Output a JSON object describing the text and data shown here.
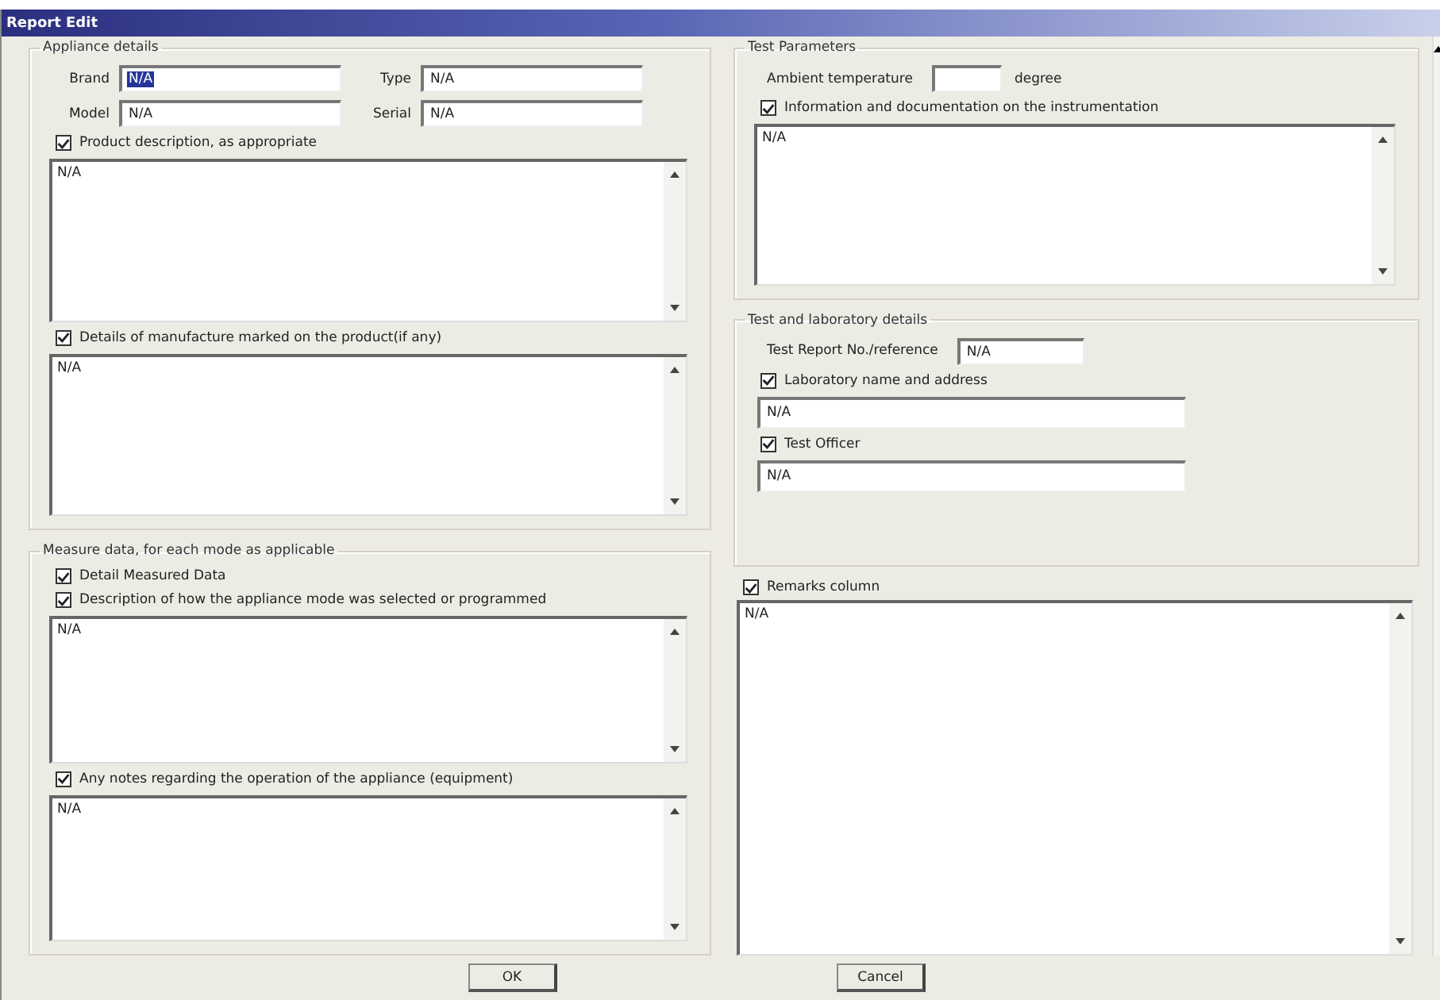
{
  "window": {
    "title": "Report Edit"
  },
  "left_groups": [
    {
      "title": "Appliance details",
      "items": [
        {
          "kind": "field_row",
          "fields": [
            {
              "label": "Brand",
              "value": "N/A",
              "text_selected": true
            },
            {
              "label": "Type",
              "value": "N/A",
              "text_selected": false
            }
          ]
        },
        {
          "kind": "field_row",
          "fields": [
            {
              "label": "Model",
              "value": "N/A",
              "text_selected": false
            },
            {
              "label": "Serial",
              "value": "N/A",
              "text_selected": false
            }
          ]
        },
        {
          "kind": "checkbox",
          "label": "Product description, as appropriate",
          "checked": true
        },
        {
          "kind": "textarea",
          "value": "N/A"
        },
        {
          "kind": "checkbox",
          "label": "Details of manufacture marked on the product(if any)",
          "checked": true
        },
        {
          "kind": "textarea",
          "value": "N/A"
        }
      ]
    },
    {
      "title": "Measure data, for each mode as applicable",
      "items": [
        {
          "kind": "checkbox",
          "label": "Detail Measured Data",
          "checked": true
        },
        {
          "kind": "checkbox",
          "label": "Description of how the appliance mode was selected or programmed",
          "checked": true
        },
        {
          "kind": "textarea",
          "value": "N/A"
        },
        {
          "kind": "checkbox",
          "label": "Any notes regarding the operation of the appliance (equipment)",
          "checked": true
        },
        {
          "kind": "textarea",
          "value": "N/A"
        }
      ]
    }
  ],
  "right_groups": [
    {
      "title": "Test Parameters",
      "items": [
        {
          "kind": "inline_field",
          "label": "Ambient temperature",
          "unit": "degree"
        },
        {
          "kind": "checkbox",
          "label": "Information and documentation on the instrumentation",
          "checked": true
        },
        {
          "kind": "textarea",
          "value": "N/A"
        }
      ]
    },
    {
      "title": "Test and laboratory details",
      "items": [
        {
          "kind": "inline_field",
          "label": "Test Report No./reference",
          "value": "N/A"
        },
        {
          "kind": "checkbox",
          "label": "Laboratory name and address",
          "checked": true
        },
        {
          "kind": "line_field",
          "value": "N/A"
        },
        {
          "kind": "checkbox",
          "label": "Test Officer",
          "checked": true
        },
        {
          "kind": "line_field",
          "value": "N/A"
        }
      ]
    }
  ],
  "remarks": {
    "label": "Remarks column",
    "checked": true,
    "value": "N/A"
  },
  "buttons": [
    "OK",
    "Cancel"
  ]
}
